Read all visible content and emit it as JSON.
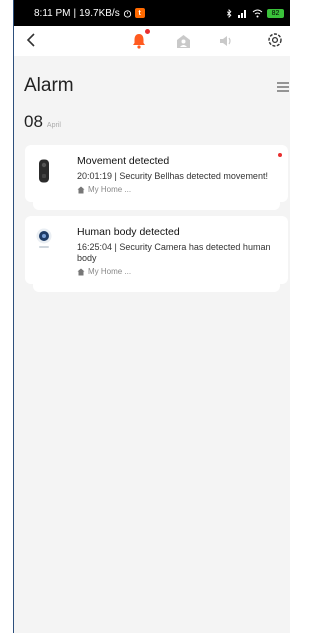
{
  "statusbar": {
    "time": "8:11 PM",
    "speed": "19.7KB/s",
    "battery": "82"
  },
  "topbar": {
    "back_icon": "chevron-left-icon",
    "tabs": [
      "bell-icon",
      "home-person-icon",
      "speaker-icon"
    ],
    "settings_icon": "gear-icon"
  },
  "page": {
    "title": "Alarm",
    "menu_icon": "filter-menu-icon"
  },
  "date_group": {
    "day": "08",
    "month": "April"
  },
  "alarms": [
    {
      "title": "Movement detected",
      "description": "20:01:19 | Security Bellhas detected movement!",
      "location": "My Home ...",
      "unread": true,
      "device": "doorbell"
    },
    {
      "title": "Human body detected",
      "description": "16:25:04 | Security Camera has detected human body",
      "location": "My Home ...",
      "unread": false,
      "device": "camera"
    }
  ],
  "colors": {
    "accent": "#ff5a1f",
    "unread_dot": "#e82f2f",
    "background": "#f4f4f4"
  }
}
